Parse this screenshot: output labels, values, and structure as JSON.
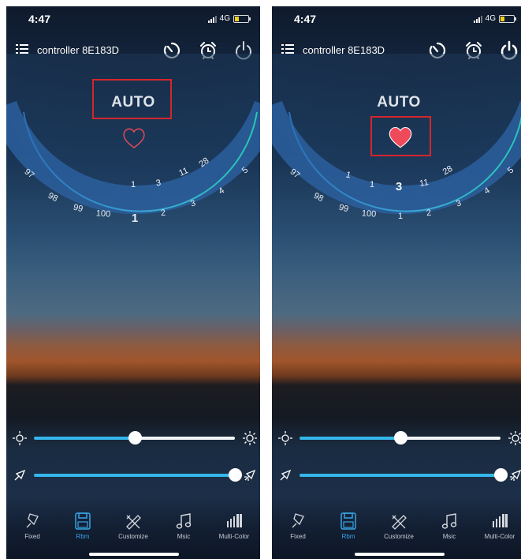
{
  "screens": [
    {
      "status": {
        "time": "4:47",
        "network": "4G"
      },
      "header": {
        "device_name": "controller 8E183D"
      },
      "mode_label": "AUTO",
      "heart_state": "outline",
      "dial": {
        "outer_numbers": [
          "97",
          "98",
          "99",
          "100",
          "1",
          "2",
          "3",
          "4",
          "5"
        ],
        "inner_numbers": [
          "1",
          "3",
          "11",
          "28"
        ],
        "selected": "1"
      },
      "sliders": {
        "brightness_percent": 50,
        "speed_percent": 100
      },
      "tabs": [
        {
          "label": "Fixed",
          "icon": "pin-icon"
        },
        {
          "label": "Rbm",
          "icon": "save-icon"
        },
        {
          "label": "Customize",
          "icon": "pen-ruler-icon"
        },
        {
          "label": "Msic",
          "icon": "music-note-icon"
        },
        {
          "label": "Multi-Color",
          "icon": "equalizer-icon"
        }
      ],
      "active_tab": "Rbm",
      "colors": {
        "accent": "#35b7ea",
        "highlight": "#d5252b",
        "heart": "#ef4a5c"
      }
    },
    {
      "status": {
        "time": "4:47",
        "network": "4G"
      },
      "header": {
        "device_name": "controller 8E183D"
      },
      "mode_label": "AUTO",
      "heart_state": "filled",
      "dial": {
        "outer_numbers": [
          "97",
          "98",
          "99",
          "100",
          "1",
          "2",
          "3",
          "4",
          "5"
        ],
        "inner_numbers": [
          "1",
          "1",
          "3",
          "11",
          "28"
        ],
        "selected": "3"
      },
      "sliders": {
        "brightness_percent": 50,
        "speed_percent": 100
      },
      "tabs": [
        {
          "label": "Fixed",
          "icon": "pin-icon"
        },
        {
          "label": "Rbm",
          "icon": "save-icon"
        },
        {
          "label": "Customize",
          "icon": "pen-ruler-icon"
        },
        {
          "label": "Msic",
          "icon": "music-note-icon"
        },
        {
          "label": "Multi-Color",
          "icon": "equalizer-icon"
        }
      ],
      "active_tab": "Rbm",
      "colors": {
        "accent": "#35b7ea",
        "highlight": "#d5252b",
        "heart": "#ef4a5c"
      }
    }
  ]
}
